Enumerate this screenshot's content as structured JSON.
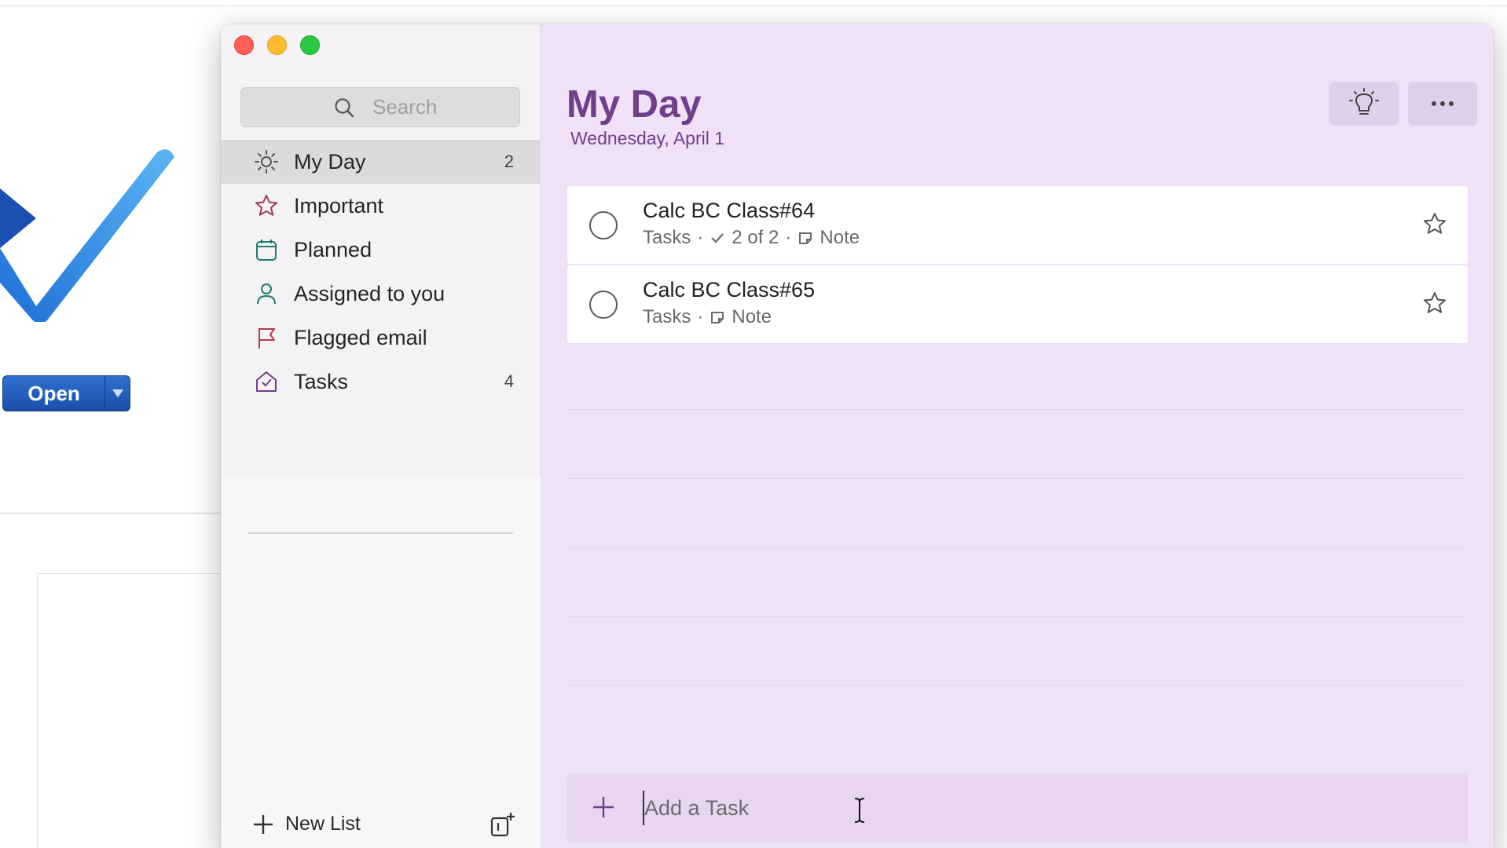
{
  "background_app": {
    "open_button_label": "Open"
  },
  "sidebar": {
    "search": {
      "placeholder": "Search"
    },
    "items": [
      {
        "label": "My Day",
        "count": "2",
        "icon": "sun-icon",
        "active": true
      },
      {
        "label": "Important",
        "count": "",
        "icon": "star-icon"
      },
      {
        "label": "Planned",
        "count": "",
        "icon": "calendar-icon"
      },
      {
        "label": "Assigned to you",
        "count": "",
        "icon": "person-icon"
      },
      {
        "label": "Flagged email",
        "count": "",
        "icon": "flag-icon"
      },
      {
        "label": "Tasks",
        "count": "4",
        "icon": "home-icon"
      }
    ],
    "new_list_label": "New List"
  },
  "main": {
    "title": "My Day",
    "date": "Wednesday, April 1",
    "tasks": [
      {
        "title": "Calc BC Class#64",
        "list": "Tasks",
        "steps": "2 of 2",
        "note": "Note"
      },
      {
        "title": "Calc BC Class#65",
        "list": "Tasks",
        "note": "Note"
      }
    ],
    "add_task_placeholder": "Add a Task"
  },
  "colors": {
    "accent": "#6f3f8c",
    "main_bg": "#f0e1f6",
    "sidebar_bg": "#f4f2f4"
  }
}
